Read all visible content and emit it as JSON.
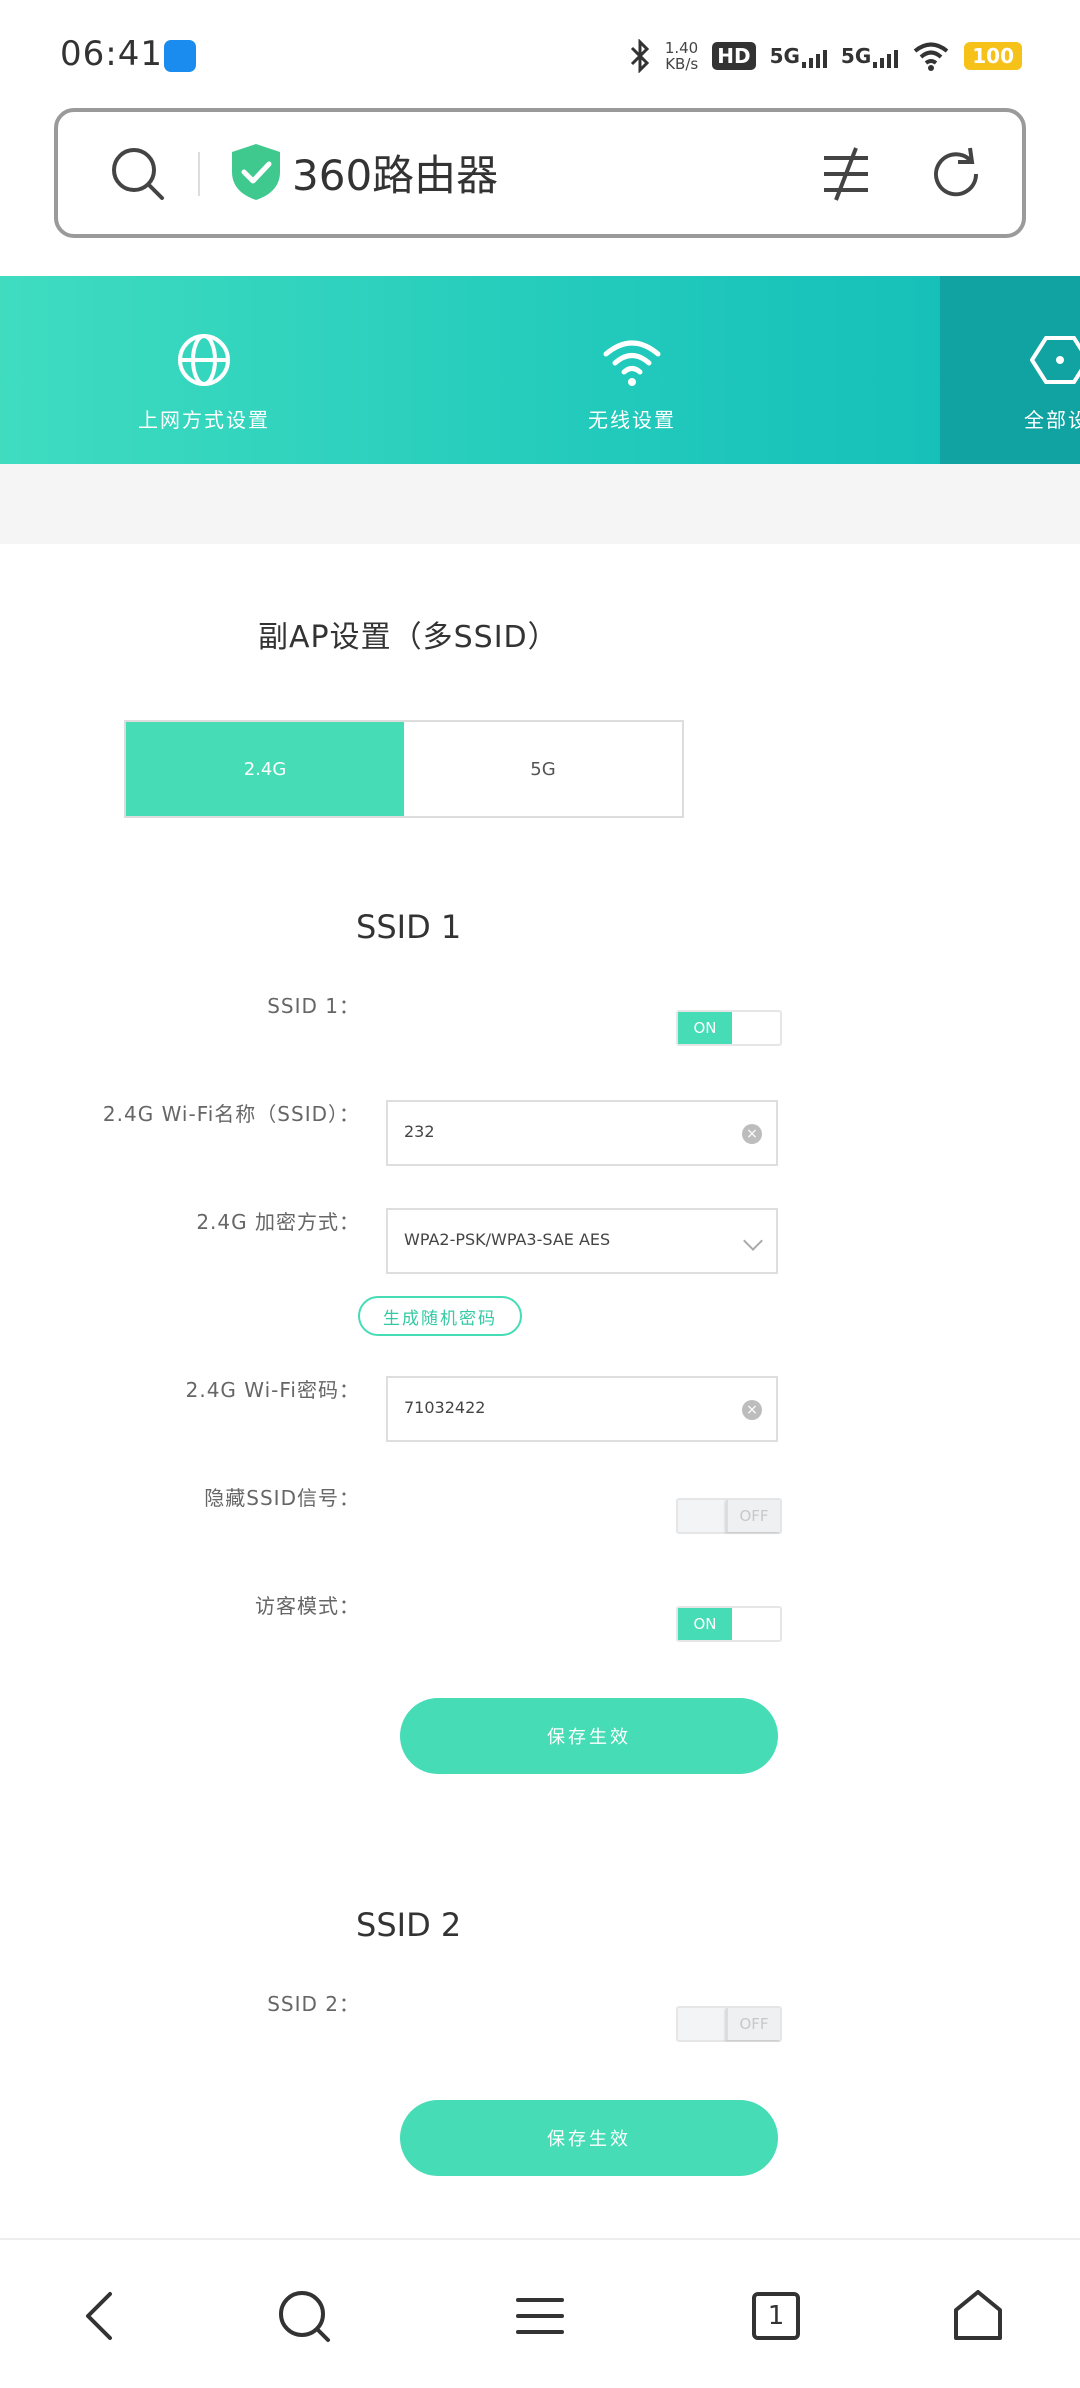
{
  "status_bar": {
    "time": "06:41",
    "network_speed_value": "1.40",
    "network_speed_unit": "KB/s",
    "hd_label": "HD",
    "sim1_label": "5G",
    "sim2_label": "5G",
    "battery": "100"
  },
  "browser": {
    "site_title": "360路由器"
  },
  "top_nav": {
    "items": [
      {
        "label": "上网方式设置",
        "icon": "globe-icon"
      },
      {
        "label": "无线设置",
        "icon": "wifi-icon"
      },
      {
        "label": "全部设",
        "icon": "hexagon-icon"
      }
    ]
  },
  "page": {
    "title": "副AP设置（多SSID）",
    "tabs": [
      "2.4G",
      "5G"
    ],
    "active_tab": "2.4G"
  },
  "ssid1": {
    "section_title": "SSID 1",
    "enable_label": "SSID 1：",
    "enable_state": "ON",
    "name_label": "2.4G Wi-Fi名称（SSID）：",
    "name_value": "232",
    "encryption_label": "2.4G 加密方式：",
    "encryption_value": "WPA2-PSK/WPA3-SAE AES",
    "random_password_button": "生成随机密码",
    "password_label": "2.4G Wi-Fi密码：",
    "password_value": "71032422",
    "hide_ssid_label": "隐藏SSID信号：",
    "hide_ssid_state": "OFF",
    "guest_mode_label": "访客模式：",
    "guest_mode_state": "ON",
    "save_button": "保存生效"
  },
  "ssid2": {
    "section_title": "SSID 2",
    "enable_label": "SSID 2：",
    "enable_state": "OFF",
    "save_button": "保存生效"
  },
  "bottom_nav": {
    "tab_count": "1"
  },
  "colors": {
    "accent": "#45dcb6",
    "nav_gradient_start": "#3fdcc0",
    "nav_gradient_end": "#12bcb8",
    "battery": "#f6c21a"
  }
}
